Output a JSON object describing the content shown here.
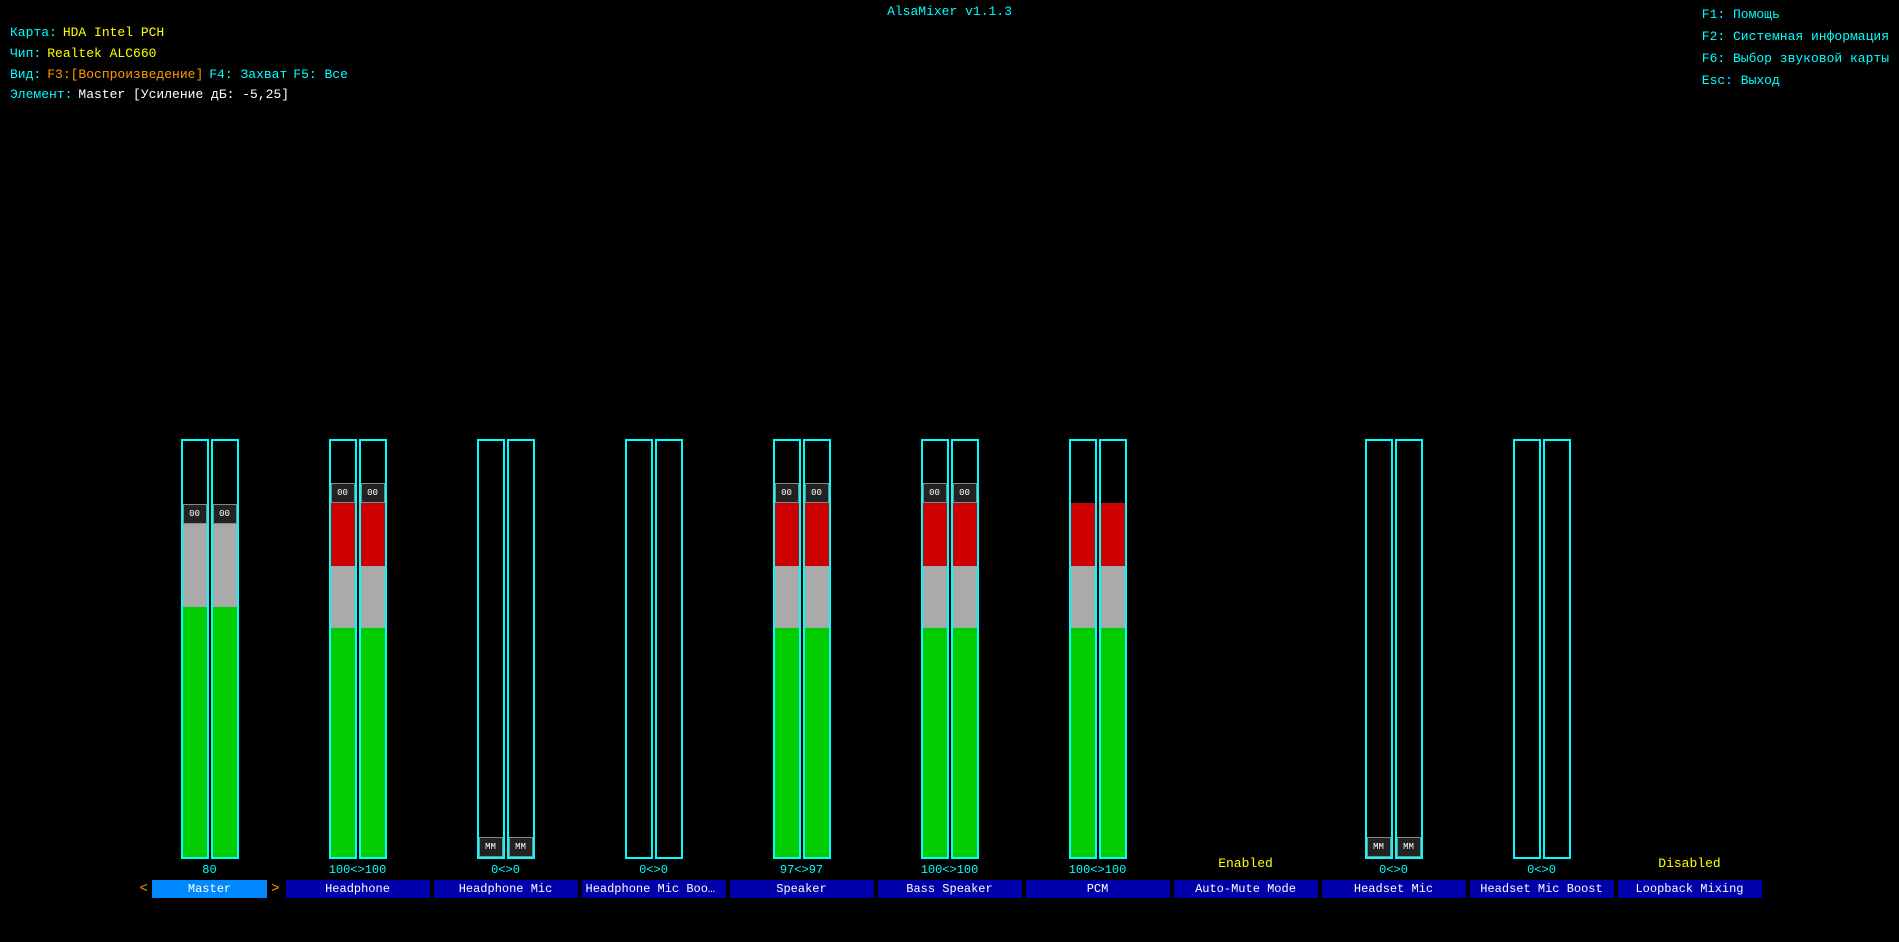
{
  "title": "AlsaMixer v1.1.3",
  "header": {
    "card_label": "Карта:",
    "card_value": "HDA Intel PCH",
    "chip_label": "Чип:",
    "chip_value": "Realtek ALC660",
    "view_label": "Вид:",
    "view_f3": "F3:[Воспроизведение]",
    "view_f4": "F4: Захват",
    "view_f5": "F5: Все",
    "elem_label": "Элемент:",
    "elem_value": "Master [Усиление дБ: -5,25]"
  },
  "help": {
    "f1": "F1: Помощь",
    "f2": "F2: Системная информация",
    "f6": "F6: Выбор звуковой карты",
    "esc": "Esc: Выход"
  },
  "channels": [
    {
      "name": "Master",
      "value": "80",
      "range": "80",
      "stereo": true,
      "active": true,
      "fillGreenPct": 60,
      "fillGreyPct": 20,
      "fillRedPct": 0,
      "has_knob": true,
      "knob_label": "00",
      "has_arrows": true
    },
    {
      "name": "Headphone",
      "value": "100<>100",
      "range": "100<>100",
      "stereo": true,
      "active": false,
      "fillGreenPct": 55,
      "fillGreyPct": 15,
      "fillRedPct": 15,
      "has_knob": true,
      "knob_label": "00",
      "has_arrows": false
    },
    {
      "name": "Headphone Mic",
      "value": "0<>0",
      "range": "0<>0",
      "stereo": true,
      "active": false,
      "fillGreenPct": 0,
      "fillGreyPct": 0,
      "fillRedPct": 0,
      "has_knob": true,
      "knob_label": "MM",
      "has_arrows": false
    },
    {
      "name": "Headphone Mic Boost",
      "value": "0<>0",
      "range": "0<>0",
      "stereo": true,
      "active": false,
      "fillGreenPct": 0,
      "fillGreyPct": 0,
      "fillRedPct": 0,
      "has_knob": false,
      "knob_label": "",
      "has_arrows": false
    },
    {
      "name": "Speaker",
      "value": "97<>97",
      "range": "97<>97",
      "stereo": true,
      "active": false,
      "fillGreenPct": 55,
      "fillGreyPct": 15,
      "fillRedPct": 15,
      "has_knob": true,
      "knob_label": "00",
      "has_arrows": false
    },
    {
      "name": "Bass Speaker",
      "value": "100<>100",
      "range": "100<>100",
      "stereo": true,
      "active": false,
      "fillGreenPct": 55,
      "fillGreyPct": 15,
      "fillRedPct": 15,
      "has_knob": true,
      "knob_label": "00",
      "has_arrows": false
    },
    {
      "name": "PCM",
      "value": "100<>100",
      "range": "100<>100",
      "stereo": true,
      "active": false,
      "fillGreenPct": 55,
      "fillGreyPct": 15,
      "fillRedPct": 15,
      "has_knob": false,
      "knob_label": "",
      "has_arrows": false
    },
    {
      "name": "Auto-Mute Mode",
      "value": "Enabled",
      "range": "",
      "stereo": false,
      "active": false,
      "fillGreenPct": 0,
      "fillGreyPct": 0,
      "fillRedPct": 0,
      "has_knob": false,
      "knob_label": "",
      "has_arrows": false,
      "is_enum": true,
      "enum_value": "Enabled"
    },
    {
      "name": "Headset Mic",
      "value": "0<>0",
      "range": "0<>0",
      "stereo": true,
      "active": false,
      "fillGreenPct": 0,
      "fillGreyPct": 0,
      "fillRedPct": 0,
      "has_knob": true,
      "knob_label": "MM",
      "has_arrows": false
    },
    {
      "name": "Headset Mic Boost",
      "value": "0<>0",
      "range": "0<>0",
      "stereo": true,
      "active": false,
      "fillGreenPct": 0,
      "fillGreyPct": 0,
      "fillRedPct": 0,
      "has_knob": false,
      "knob_label": "",
      "has_arrows": false
    },
    {
      "name": "Loopback Mixing",
      "value": "Disabled",
      "range": "",
      "stereo": false,
      "active": false,
      "fillGreenPct": 0,
      "fillGreyPct": 0,
      "fillRedPct": 0,
      "has_knob": false,
      "knob_label": "",
      "has_arrows": false,
      "is_enum": true,
      "enum_value": "Disabled"
    }
  ]
}
